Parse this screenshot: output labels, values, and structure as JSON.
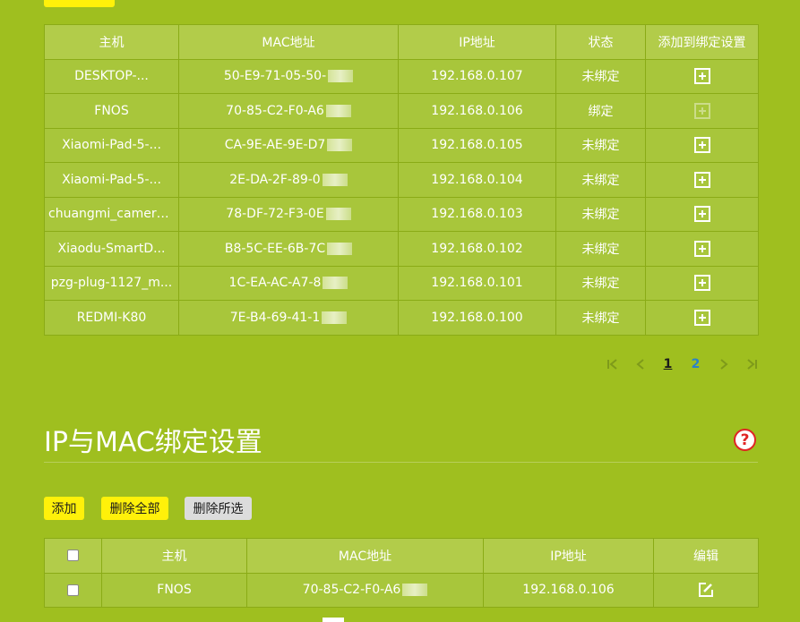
{
  "client_table": {
    "headers": [
      "主机",
      "MAC地址",
      "IP地址",
      "状态",
      "添加到绑定设置"
    ],
    "rows": [
      {
        "host": "DESKTOP-...",
        "mac": "50-E9-71-05-50-",
        "ip": "192.168.0.107",
        "status": "未绑定",
        "bound": false
      },
      {
        "host": "FNOS",
        "mac": "70-85-C2-F0-A6",
        "ip": "192.168.0.106",
        "status": "绑定",
        "bound": true
      },
      {
        "host": "Xiaomi-Pad-5-...",
        "mac": "CA-9E-AE-9E-D7",
        "ip": "192.168.0.105",
        "status": "未绑定",
        "bound": false
      },
      {
        "host": "Xiaomi-Pad-5-...",
        "mac": "2E-DA-2F-89-0",
        "ip": "192.168.0.104",
        "status": "未绑定",
        "bound": false
      },
      {
        "host": "chuangmi_camera...",
        "mac": "78-DF-72-F3-0E",
        "ip": "192.168.0.103",
        "status": "未绑定",
        "bound": false
      },
      {
        "host": "Xiaodu-SmartD...",
        "mac": "B8-5C-EE-6B-7C",
        "ip": "192.168.0.102",
        "status": "未绑定",
        "bound": false
      },
      {
        "host": "pzg-plug-1127_m...",
        "mac": "1C-EA-AC-A7-8",
        "ip": "192.168.0.101",
        "status": "未绑定",
        "bound": false
      },
      {
        "host": "REDMI-K80",
        "mac": "7E-B4-69-41-1",
        "ip": "192.168.0.100",
        "status": "未绑定",
        "bound": false
      }
    ]
  },
  "pagination": {
    "pages": [
      "1",
      "2"
    ],
    "current": "1"
  },
  "binding_section": {
    "title": "IP与MAC绑定设置",
    "help_symbol": "?",
    "buttons": {
      "add": "添加",
      "delete_all": "删除全部",
      "delete_selected": "删除所选"
    },
    "table": {
      "headers": [
        "主机",
        "MAC地址",
        "IP地址",
        "编辑"
      ],
      "rows": [
        {
          "host": "FNOS",
          "mac": "70-85-C2-F0-A6",
          "ip": "192.168.0.106"
        }
      ]
    }
  },
  "colors": {
    "background": "#9fbf1f",
    "button_yellow": "#fff10a",
    "button_gray": "#dcdcdc",
    "page_link": "#2a82c9"
  },
  "icons": [
    "plus-square-icon",
    "first-page-icon",
    "prev-page-icon",
    "next-page-icon",
    "last-page-icon",
    "help-icon",
    "edit-icon"
  ]
}
